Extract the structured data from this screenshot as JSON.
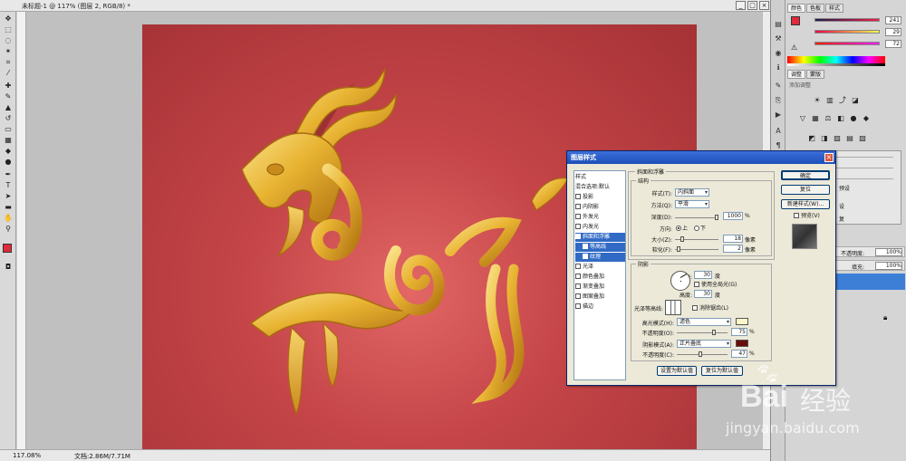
{
  "window": {
    "document_tab": "未标题-1 @ 117% (图层 2, RGB/8) *",
    "minimize": "_",
    "maximize": "□",
    "close": "×"
  },
  "status": {
    "zoom": "117.08%",
    "doc_size": "文档:2.86M/7.71M"
  },
  "colors": {
    "canvas_red": "#b83c40",
    "gold": "#e8b83a",
    "dialog_title": "#1d4fb8"
  },
  "panels": {
    "color_tabs": [
      "颜色",
      "色板",
      "样式"
    ],
    "color_values": [
      "241",
      "29",
      "72"
    ],
    "adjust_tabs": [
      "调整",
      "蒙版"
    ],
    "adjust_title": "添加调整",
    "layers_opacity_label": "不透明度:",
    "layers_opacity_value": "100%",
    "layers_fill_label": "填充:",
    "layers_fill_value": "100%",
    "side_labels": [
      "预设",
      "设",
      "复"
    ]
  },
  "dialog": {
    "title": "图层样式",
    "style_list": [
      {
        "label": "样式",
        "check": false,
        "selected": false,
        "sub": false
      },
      {
        "label": "混合选项:默认",
        "check": false,
        "selected": false,
        "sub": false
      },
      {
        "label": "投影",
        "check": true,
        "selected": false,
        "sub": false
      },
      {
        "label": "内阴影",
        "check": true,
        "selected": false,
        "sub": false
      },
      {
        "label": "外发光",
        "check": true,
        "selected": false,
        "sub": false
      },
      {
        "label": "内发光",
        "check": true,
        "selected": false,
        "sub": false
      },
      {
        "label": "斜面和浮雕",
        "check": true,
        "selected": true,
        "sub": false
      },
      {
        "label": "等高线",
        "check": true,
        "selected": true,
        "sub": true
      },
      {
        "label": "纹理",
        "check": true,
        "selected": true,
        "sub": true
      },
      {
        "label": "光泽",
        "check": true,
        "selected": false,
        "sub": false
      },
      {
        "label": "颜色叠加",
        "check": true,
        "selected": false,
        "sub": false
      },
      {
        "label": "渐变叠加",
        "check": true,
        "selected": false,
        "sub": false
      },
      {
        "label": "图案叠加",
        "check": true,
        "selected": false,
        "sub": false
      },
      {
        "label": "描边",
        "check": true,
        "selected": false,
        "sub": false
      }
    ],
    "bevel_group": "斜面和浮雕",
    "structure_group": "结构",
    "style_label": "样式(T):",
    "style_value": "内斜面",
    "technique_label": "方法(Q):",
    "technique_value": "平滑",
    "depth_label": "深度(D):",
    "depth_value": "1000",
    "depth_unit": "%",
    "direction_label": "方向:",
    "dir_up": "上",
    "dir_down": "下",
    "size_label": "大小(Z):",
    "size_value": "18",
    "size_unit": "像素",
    "soften_label": "软化(F):",
    "soften_value": "2",
    "soften_unit": "像素",
    "shading_group": "阴影",
    "angle_label": "角度(N):",
    "angle_value": "30",
    "angle_unit": "度",
    "global_light": "使用全局光(G)",
    "altitude_label": "高度:",
    "altitude_value": "30",
    "altitude_unit": "度",
    "gloss_label": "光泽等高线:",
    "antialias": "消除锯齿(L)",
    "highlight_label": "高光模式(H):",
    "highlight_value": "滤色",
    "hl_opacity_label": "不透明度(O):",
    "hl_opacity_value": "75",
    "hl_opacity_unit": "%",
    "shadow_label": "阴影模式(A):",
    "shadow_value": "正片叠底",
    "sh_opacity_label": "不透明度(C):",
    "sh_opacity_value": "47",
    "sh_opacity_unit": "%",
    "btn_make_default": "设置为默认值",
    "btn_reset_default": "复位为默认值",
    "btn_ok": "确定",
    "btn_cancel": "复位",
    "btn_new_style": "新建样式(W)...",
    "preview": "预览(V)",
    "highlight_color": "#fdf6c9",
    "shadow_color": "#6b0c0c",
    "hl_opacity_pct": 75,
    "sh_opacity_pct": 47
  },
  "watermark": {
    "brand": "Bai",
    "brand_cn": "经验",
    "url": "jingyan.baidu.com"
  }
}
